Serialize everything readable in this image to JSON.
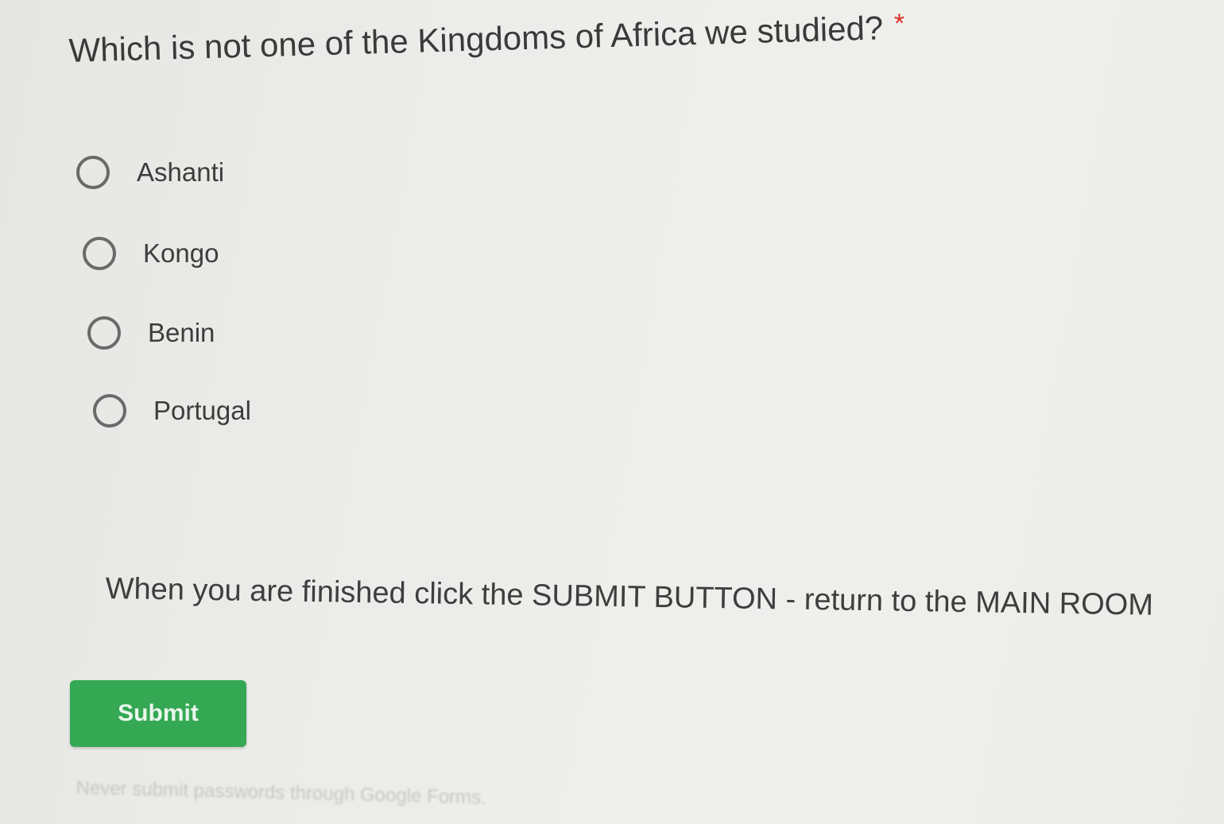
{
  "question": {
    "text": "Which is not one of the Kingdoms of Africa we studied?",
    "required_marker": "*"
  },
  "options": [
    {
      "label": "Ashanti"
    },
    {
      "label": "Kongo"
    },
    {
      "label": "Benin"
    },
    {
      "label": "Portugal"
    }
  ],
  "instruction": "When you are finished click the SUBMIT BUTTON - return to the MAIN ROOM",
  "submit": {
    "label": "Submit",
    "color": "#34a853"
  },
  "footer": {
    "text": "Never submit passwords through Google Forms."
  }
}
